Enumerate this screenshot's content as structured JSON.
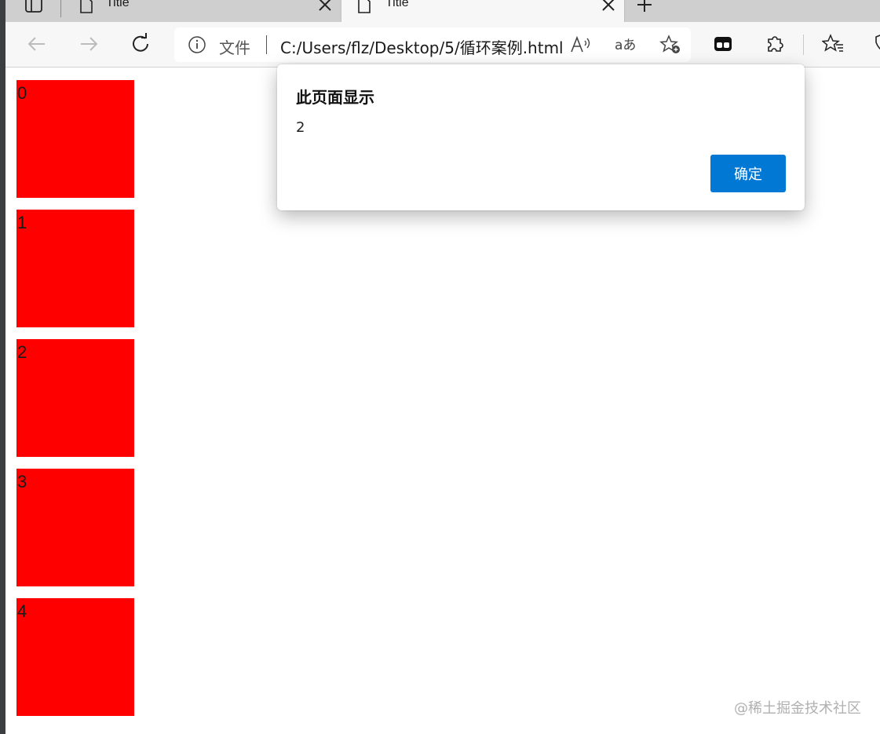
{
  "browser": {
    "tabs": [
      {
        "title": "Title"
      },
      {
        "title": "Title",
        "active": true
      }
    ],
    "address": {
      "scheme_label": "文件",
      "url": "C:/Users/flz/Desktop/5/循环案例.html"
    }
  },
  "page": {
    "boxes": [
      {
        "label": "0"
      },
      {
        "label": "1"
      },
      {
        "label": "2"
      },
      {
        "label": "3"
      },
      {
        "label": "4"
      }
    ],
    "box_color": "#ff0000"
  },
  "alert": {
    "title": "此页面显示",
    "message": "2",
    "ok_label": "确定",
    "button_color": "#0078d4"
  },
  "watermark": "@稀土掘金技术社区",
  "icons": [
    "sidebar-icon",
    "page-icon",
    "close-icon",
    "plus-icon",
    "back-icon",
    "forward-icon",
    "refresh-icon",
    "info-icon",
    "read-aloud-icon",
    "translate-icon",
    "add-favorite-icon",
    "collections-icon",
    "extensions-icon",
    "favorites-icon",
    "shield-icon"
  ]
}
